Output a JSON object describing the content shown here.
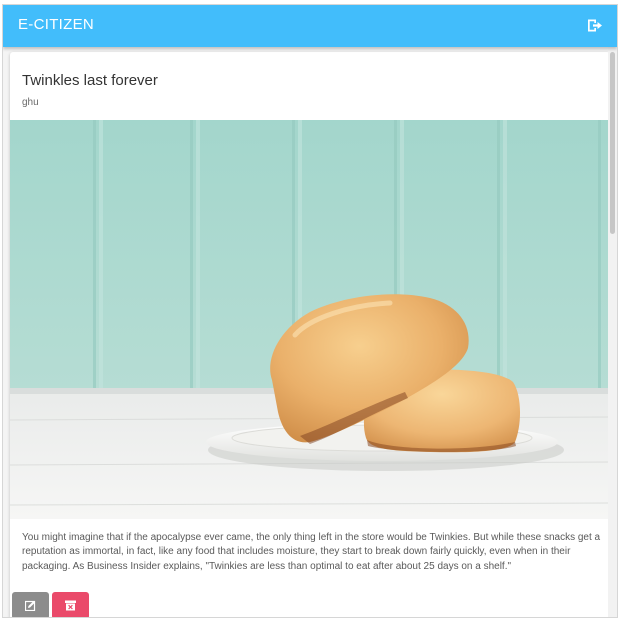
{
  "app": {
    "title": "E-CITIZEN",
    "logout_icon": "logout-icon"
  },
  "post": {
    "title": "Twinkles last forever",
    "author": "ghu",
    "image": "twinkies-on-plate",
    "body": "You might imagine that if the apocalypse ever came, the only thing left in the store would be Twinkies. But while these snacks get a reputation as immortal, in fact, like any food that includes moisture, they start to break down fairly quickly, even when in their packaging. As Business Insider explains, \"Twinkies are less than optimal to eat after about 25 days on a shelf.\"",
    "edit_icon": "edit-icon",
    "delete_icon": "archive-delete-icon"
  },
  "colors": {
    "appbar": "#42bdfb",
    "edit_button": "#8c8c8c",
    "delete_button": "#ea4a6a"
  }
}
